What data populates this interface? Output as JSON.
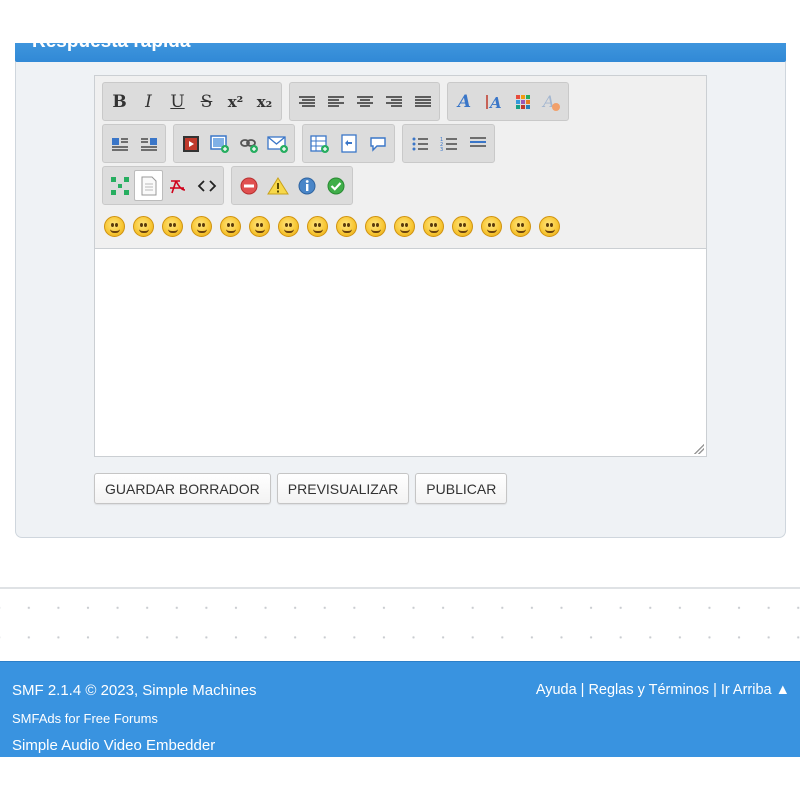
{
  "quick_reply": {
    "title": "Respuesta rápida"
  },
  "toolbar": {
    "row1": [
      {
        "group": "format",
        "buttons": [
          {
            "name": "bold-button",
            "glyph": "B"
          },
          {
            "name": "italic-button",
            "glyph": "I"
          },
          {
            "name": "underline-button",
            "glyph": "U"
          },
          {
            "name": "strike-button",
            "glyph": "S"
          },
          {
            "name": "superscript-button",
            "glyph": "x²"
          },
          {
            "name": "subscript-button",
            "glyph": "x₂"
          }
        ]
      },
      {
        "group": "align",
        "buttons": [
          {
            "name": "pre-button",
            "glyph": "≡"
          },
          {
            "name": "align-left-button",
            "glyph": "≡"
          },
          {
            "name": "align-center-button",
            "glyph": "≡"
          },
          {
            "name": "align-right-button",
            "glyph": "≡"
          },
          {
            "name": "justify-button",
            "glyph": "≡"
          }
        ]
      },
      {
        "group": "font",
        "buttons": [
          {
            "name": "font-face-button",
            "glyph": "A"
          },
          {
            "name": "font-size-button",
            "glyph": "A"
          },
          {
            "name": "font-color-button",
            "glyph": "▦"
          },
          {
            "name": "remove-format-button",
            "glyph": "A"
          }
        ]
      }
    ],
    "row2": [
      {
        "group": "float",
        "buttons": [
          {
            "name": "float-left-button",
            "glyph": "▤"
          },
          {
            "name": "float-right-button",
            "glyph": "▤"
          }
        ]
      },
      {
        "group": "media",
        "buttons": [
          {
            "name": "youtube-button",
            "glyph": "▶"
          },
          {
            "name": "image-button",
            "glyph": "▣"
          },
          {
            "name": "link-button",
            "glyph": "∞"
          },
          {
            "name": "email-button",
            "glyph": "✉"
          }
        ]
      },
      {
        "group": "insert",
        "buttons": [
          {
            "name": "table-button",
            "glyph": "▦"
          },
          {
            "name": "code-button",
            "glyph": "▧"
          },
          {
            "name": "quote-button",
            "glyph": "💬"
          }
        ]
      },
      {
        "group": "list",
        "buttons": [
          {
            "name": "bullet-list-button",
            "glyph": "☰"
          },
          {
            "name": "ordered-list-button",
            "glyph": "☰"
          },
          {
            "name": "horizontal-rule-button",
            "glyph": "▬"
          }
        ]
      }
    ],
    "row3": [
      {
        "group": "view",
        "buttons": [
          {
            "name": "maximize-button",
            "glyph": "⛶"
          },
          {
            "name": "source-button",
            "glyph": "▯"
          },
          {
            "name": "pdf-button",
            "glyph": "⚐"
          },
          {
            "name": "toggle-source-button",
            "glyph": "‹›"
          }
        ]
      },
      {
        "group": "notices",
        "buttons": [
          {
            "name": "error-button",
            "glyph": "⊖"
          },
          {
            "name": "warning-button",
            "glyph": "⚠"
          },
          {
            "name": "info-button",
            "glyph": "ℹ"
          },
          {
            "name": "success-button",
            "glyph": "✔"
          }
        ]
      }
    ]
  },
  "smileys_count": 16,
  "actions": {
    "draft": "GUARDAR BORRADOR",
    "preview": "PREVISUALIZAR",
    "post": "PUBLICAR"
  },
  "footer": {
    "copyright": "SMF 2.1.4 © 2023, Simple Machines",
    "ads": "SMFAds for Free Forums",
    "embedder": "Simple Audio Video Embedder",
    "help": "Ayuda",
    "terms": "Reglas y Términos",
    "top": "Ir Arriba ▲"
  },
  "colors": {
    "header": "#3189d6",
    "footer": "#3993e0",
    "panel": "#eff2f5"
  }
}
